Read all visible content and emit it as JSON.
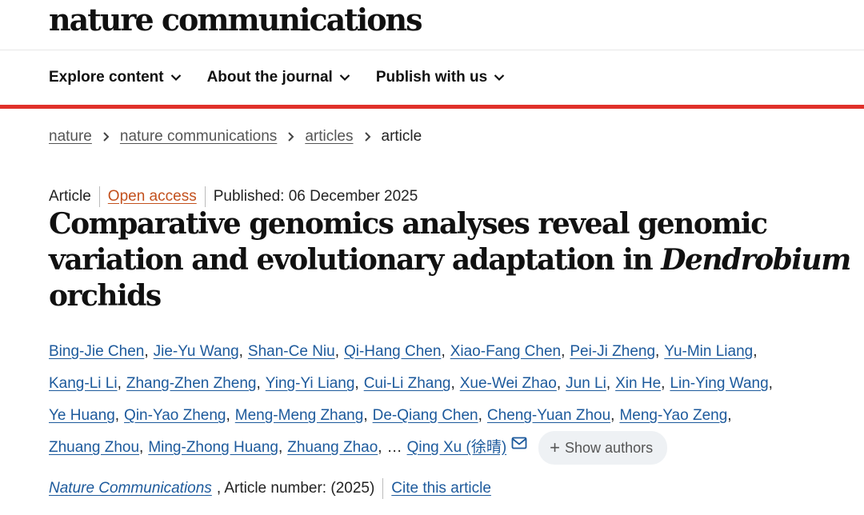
{
  "header": {
    "logo": "nature communications"
  },
  "nav": {
    "items": [
      {
        "label": "Explore content"
      },
      {
        "label": "About the journal"
      },
      {
        "label": "Publish with us"
      }
    ]
  },
  "breadcrumb": {
    "items": [
      "nature",
      "nature communications",
      "articles"
    ],
    "current": "article"
  },
  "article_meta": {
    "type": "Article",
    "access": "Open access",
    "published": "Published: 06 December 2025"
  },
  "title": {
    "line1": "Comparative genomics analyses reveal genomic",
    "line2_prefix": "variation and evolutionary adaptation in ",
    "line2_italic": "Dendrobium",
    "line3": "orchids"
  },
  "authors": {
    "line1": [
      "Bing-Jie Chen",
      "Jie-Yu Wang",
      "Shan-Ce Niu",
      "Qi-Hang Chen",
      "Xiao-Fang Chen",
      "Pei-Ji Zheng",
      "Yu-Min Liang"
    ],
    "line2": [
      "Kang-Li Li",
      "Zhang-Zhen Zheng",
      "Ying-Yi Liang",
      "Cui-Li Zhang",
      "Xue-Wei Zhao",
      "Jun Li",
      "Xin He",
      "Lin-Ying Wang"
    ],
    "line3": [
      "Ye Huang",
      "Qin-Yao Zheng",
      "Meng-Meng Zhang",
      "De-Qiang Chen",
      "Cheng-Yuan Zhou",
      "Meng-Yao Zeng"
    ],
    "line4": [
      "Zhuang Zhou",
      "Ming-Zhong Huang",
      "Zhuang Zhao"
    ],
    "ellipsis": "…",
    "corresponding": "Qing Xu (徐晴)",
    "show_authors": "Show authors",
    "mail_icon": "mail-icon"
  },
  "citation": {
    "journal": "Nature Communications",
    "article_number": ", Article number:  (2025)",
    "cite": "Cite this article"
  },
  "colors": {
    "accent_red": "#e0302a",
    "link_blue": "#1d5a9c",
    "open_access": "#c3511e"
  }
}
